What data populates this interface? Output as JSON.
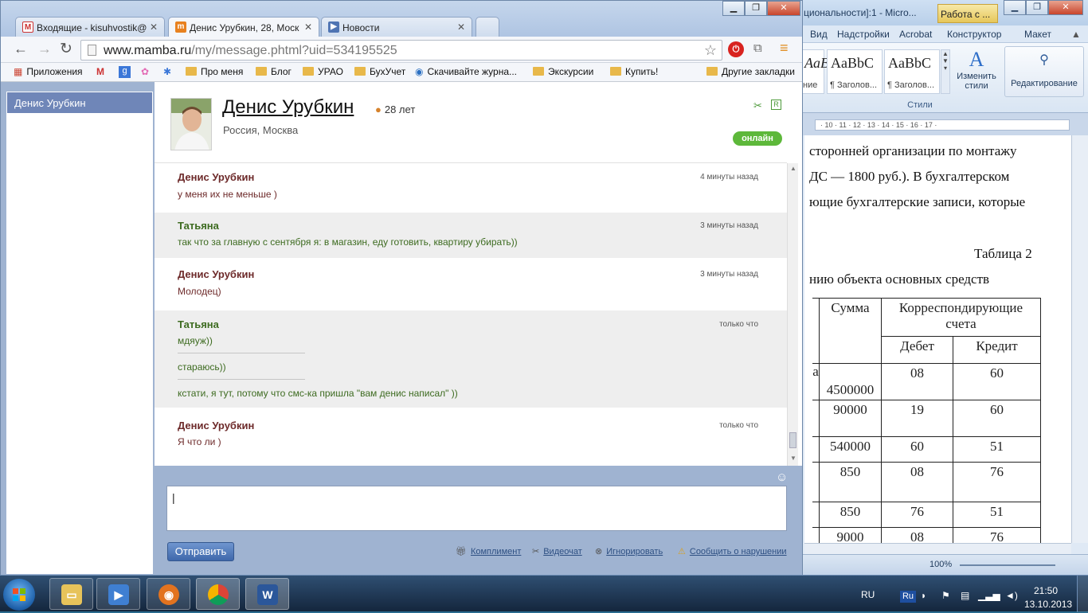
{
  "word": {
    "title": "циональности]:1 - Micro...",
    "context_tab": "Работа с ...",
    "menu": [
      "Вид",
      "Надстройки",
      "Acrobat",
      "Конструктор",
      "Макет"
    ],
    "styles": [
      {
        "sample": "AaBbCcI",
        "label": "ние"
      },
      {
        "sample": "AaBbC",
        "label": "¶ Заголов..."
      },
      {
        "sample": "AaBbC",
        "label": "¶ Заголов..."
      }
    ],
    "change_styles": "Изменить стили",
    "editing": "Редактирование",
    "styles_group": "Стили",
    "ruler": "· 10 · 11 · 12 · 13 · 14 · 15 · 16 · 17 ·",
    "lines": [
      "сторонней организации по монтажу",
      "ДС — 1800 руб.). В бухгалтерском",
      "ющие бухгалтерские записи, которые"
    ],
    "table_caption": "Таблица 2",
    "table_title": "нию объекта основных средств",
    "table": {
      "header_sum": "Сумма",
      "header_corr": "Корреспондирующие счета",
      "header_debit": "Дебет",
      "header_credit": "Кредит",
      "rows": [
        {
          "first": "а",
          "sum": "4500000",
          "debit": "08",
          "credit": "60"
        },
        {
          "first": "",
          "sum": "90000",
          "debit": "19",
          "credit": "60"
        },
        {
          "first": "",
          "sum": "540000",
          "debit": "60",
          "credit": "51"
        },
        {
          "first": "",
          "sum": "850",
          "debit": "08",
          "credit": "76"
        },
        {
          "first": "",
          "sum": "850",
          "debit": "76",
          "credit": "51"
        },
        {
          "first": "",
          "sum": "9000",
          "debit": "08",
          "credit": "76"
        }
      ]
    },
    "zoom": "100%"
  },
  "chrome": {
    "tabs": [
      {
        "label": "Входящие - kisuhvostik@",
        "icon": "gmail-icon",
        "active": false
      },
      {
        "label": "Денис Урубкин, 28, Моск",
        "icon": "mamba-icon",
        "active": true
      },
      {
        "label": "Новости",
        "icon": "news-icon",
        "active": false
      }
    ],
    "url_host": "www.mamba.ru",
    "url_path": "/my/message.phtml?uid=534195525",
    "bookmarks": [
      "Приложения",
      "Про меня",
      "Блог",
      "УРАО",
      "БухУчет",
      "Скачивайте журна...",
      "Экскурсии",
      "Купить!",
      "Другие закладки"
    ]
  },
  "chat": {
    "sidebar_contact": "Денис Урубкин",
    "name": "Денис Урубкин",
    "age": "28 лет",
    "location": "Россия, Москва",
    "status": "онлайн",
    "messages": [
      {
        "author": "Денис Урубкин",
        "time": "4 минуты назад",
        "lines": [
          "у меня их не меньше )"
        ]
      },
      {
        "author": "Татьяна",
        "time": "3 минуты назад",
        "lines": [
          "так что за главную с сентября я: в магазин, еду готовить, квартиру убирать))"
        ]
      },
      {
        "author": "Денис Урубкин",
        "time": "3 минуты назад",
        "lines": [
          "Молодец)"
        ]
      },
      {
        "author": "Татьяна",
        "time": "только что",
        "lines": [
          "мдяуж))",
          "стараюсь))",
          "кстати, я тут, потому что смс-ка пришла \"вам денис написал\" ))"
        ]
      },
      {
        "author": "Денис Урубкин",
        "time": "только что",
        "lines": [
          "Я что ли )"
        ]
      }
    ],
    "send": "Отправить",
    "actions": [
      "Комплимент",
      "Видеочат",
      "Игнорировать",
      "Сообщить о нарушении"
    ]
  },
  "taskbar": {
    "lang": "RU",
    "lang_badge": "Ru",
    "time": "21:50",
    "date": "13.10.2013"
  }
}
